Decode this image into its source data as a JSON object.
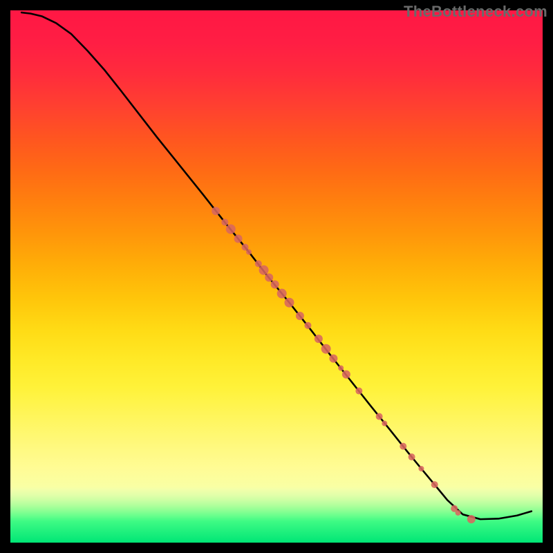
{
  "watermark": "TheBottleneck.com",
  "chart_data": {
    "type": "line",
    "title": "",
    "xlabel": "",
    "ylabel": "",
    "xlim": [
      0,
      100
    ],
    "ylim": [
      0,
      100
    ],
    "background_gradient": {
      "direction": "vertical",
      "stops": [
        {
          "pos": 0.0,
          "color": "#ff1744"
        },
        {
          "pos": 0.06,
          "color": "#ff1e44"
        },
        {
          "pos": 0.12,
          "color": "#ff2c3c"
        },
        {
          "pos": 0.18,
          "color": "#ff4030"
        },
        {
          "pos": 0.24,
          "color": "#ff5520"
        },
        {
          "pos": 0.3,
          "color": "#ff6a15"
        },
        {
          "pos": 0.36,
          "color": "#ff800e"
        },
        {
          "pos": 0.42,
          "color": "#ff960a"
        },
        {
          "pos": 0.48,
          "color": "#ffae08"
        },
        {
          "pos": 0.54,
          "color": "#ffc50a"
        },
        {
          "pos": 0.6,
          "color": "#ffdb15"
        },
        {
          "pos": 0.66,
          "color": "#ffea28"
        },
        {
          "pos": 0.71,
          "color": "#fff23a"
        },
        {
          "pos": 0.77,
          "color": "#fff660"
        },
        {
          "pos": 0.82,
          "color": "#fff97f"
        },
        {
          "pos": 0.86,
          "color": "#fffc95"
        },
        {
          "pos": 0.895,
          "color": "#f9ffa4"
        },
        {
          "pos": 0.9,
          "color": "#f2ffaa"
        },
        {
          "pos": 0.91,
          "color": "#e3ffaa"
        },
        {
          "pos": 0.92,
          "color": "#ccffa4"
        },
        {
          "pos": 0.93,
          "color": "#b0ff9c"
        },
        {
          "pos": 0.94,
          "color": "#8dff94"
        },
        {
          "pos": 0.95,
          "color": "#66ff8c"
        },
        {
          "pos": 0.96,
          "color": "#3efa84"
        },
        {
          "pos": 1.0,
          "color": "#00e676"
        }
      ]
    },
    "series": [
      {
        "name": "curve",
        "x": [
          2.1,
          3.8,
          5.9,
          8.6,
          11.4,
          14.5,
          17.6,
          20.7,
          23.8,
          27.6,
          31.7,
          36.2,
          40.6,
          44.5,
          48.3,
          52.4,
          56.2,
          60.0,
          63.8,
          67.6,
          71.4,
          74.5,
          77.2,
          79.7,
          82.1,
          85.0,
          88.3,
          91.7,
          95.2,
          97.9
        ],
        "y": [
          99.6,
          99.4,
          98.9,
          97.6,
          95.6,
          92.4,
          88.9,
          85.0,
          81.0,
          76.1,
          71.0,
          65.4,
          59.8,
          55.0,
          50.1,
          45.1,
          40.3,
          35.4,
          30.6,
          25.8,
          21.1,
          17.2,
          13.9,
          10.9,
          8.0,
          5.3,
          4.4,
          4.5,
          5.1,
          5.9
        ]
      }
    ],
    "scatter": {
      "name": "highlighted-points",
      "color": "#d8675e",
      "points": [
        {
          "x": 38.6,
          "y": 62.3,
          "r": 6
        },
        {
          "x": 40.3,
          "y": 60.2,
          "r": 5
        },
        {
          "x": 41.4,
          "y": 58.9,
          "r": 7
        },
        {
          "x": 42.8,
          "y": 57.1,
          "r": 6
        },
        {
          "x": 44.1,
          "y": 55.5,
          "r": 5
        },
        {
          "x": 44.8,
          "y": 54.6,
          "r": 4
        },
        {
          "x": 46.6,
          "y": 52.4,
          "r": 5
        },
        {
          "x": 47.6,
          "y": 51.2,
          "r": 7
        },
        {
          "x": 48.6,
          "y": 49.8,
          "r": 6
        },
        {
          "x": 49.7,
          "y": 48.5,
          "r": 6
        },
        {
          "x": 51.0,
          "y": 46.8,
          "r": 7
        },
        {
          "x": 52.4,
          "y": 45.1,
          "r": 7
        },
        {
          "x": 54.4,
          "y": 42.6,
          "r": 6
        },
        {
          "x": 55.9,
          "y": 40.8,
          "r": 5
        },
        {
          "x": 57.9,
          "y": 38.3,
          "r": 6
        },
        {
          "x": 59.3,
          "y": 36.4,
          "r": 7
        },
        {
          "x": 60.7,
          "y": 34.6,
          "r": 6
        },
        {
          "x": 62.1,
          "y": 32.8,
          "r": 4
        },
        {
          "x": 63.1,
          "y": 31.6,
          "r": 6
        },
        {
          "x": 65.5,
          "y": 28.5,
          "r": 5
        },
        {
          "x": 69.3,
          "y": 23.7,
          "r": 5
        },
        {
          "x": 70.3,
          "y": 22.4,
          "r": 4
        },
        {
          "x": 73.8,
          "y": 18.1,
          "r": 5
        },
        {
          "x": 75.4,
          "y": 16.1,
          "r": 5
        },
        {
          "x": 77.2,
          "y": 13.9,
          "r": 4
        },
        {
          "x": 79.7,
          "y": 10.9,
          "r": 5
        },
        {
          "x": 83.4,
          "y": 6.4,
          "r": 5
        },
        {
          "x": 84.1,
          "y": 5.6,
          "r": 4
        },
        {
          "x": 86.6,
          "y": 4.4,
          "r": 6
        }
      ]
    }
  }
}
